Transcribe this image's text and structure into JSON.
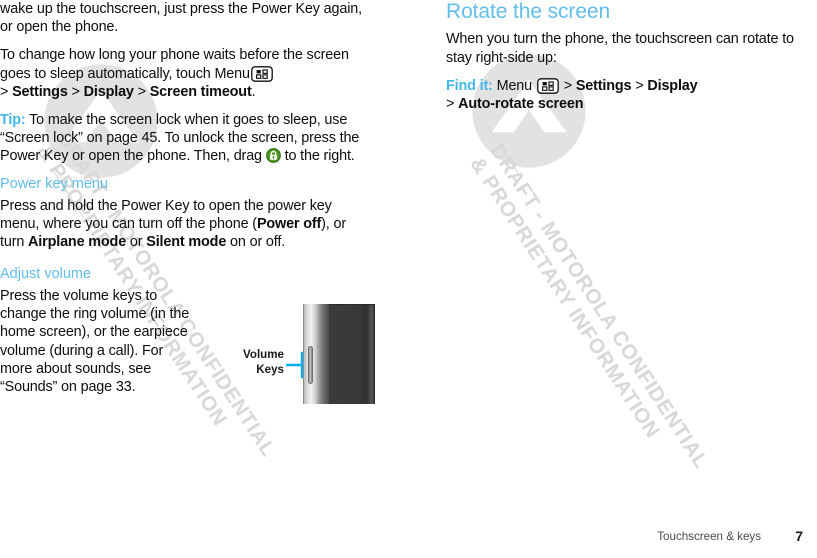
{
  "document": {
    "watermark": {
      "line1": "DRAFT - MOTOROLA CONFIDENTIAL",
      "line2": "& PROPRIETARY INFORMATION",
      "logo_name": "motorola-m-logo",
      "color": "#d8d8d8"
    },
    "footer": {
      "section_title": "Touchscreen & keys",
      "page_number": "7"
    },
    "colors": {
      "heading": "#62bdeb",
      "subheading": "#62bdeb",
      "lead_in": "#45b6e8",
      "body": "#0d0d0d",
      "callout_rule": "#00b0f0",
      "lock_icon": "#3f8f1e"
    }
  },
  "left_column": {
    "continued_paragraph": {
      "part1": "wake up the touchscreen, just press the Power Key again, or open the phone."
    },
    "timeout_paragraph": {
      "part1": "To change how long your phone waits before the screen goes to sleep automatically, touch Menu",
      "icon": "menu-grid-icon",
      "part2": " > ",
      "bold1": "Settings",
      "sep1": " > ",
      "bold2": "Display",
      "sep2": " > ",
      "bold3": "Screen timeout",
      "part3": "."
    },
    "tip_paragraph": {
      "label": "Tip:",
      "part1": " To make the screen lock when it goes to sleep, use “Screen lock” on page 45. To unlock the screen, press the Power Key or open the phone. Then, drag ",
      "icon": "lock-icon",
      "part2": " to the right."
    },
    "power_key_menu": {
      "heading": "Power key menu",
      "part1": "Press and hold the Power Key to open the power key menu, where you can turn off the phone (",
      "bold1": "Power off",
      "part2": "), or turn ",
      "bold2": "Airplane mode",
      "part3": " or ",
      "bold3": "Silent mode",
      "part4": " on or off."
    },
    "adjust_volume": {
      "heading": "Adjust volume",
      "paragraph": "Press the volume keys to change the ring volume (in the home screen), or the earpiece volume (during a call). For more about sounds, see “Sounds” on page 33."
    },
    "figure": {
      "callout_line1": "Volume",
      "callout_line2": "Keys",
      "image_name": "phone-side-view"
    }
  },
  "right_column": {
    "rotate_the_screen": {
      "heading": "Rotate the screen",
      "paragraph": "When you turn the phone, the touchscreen can rotate to stay right-side up:",
      "find_it": {
        "label": "Find it:",
        "menu_word": " Menu ",
        "icon": "menu-grid-icon",
        "sep1": " > ",
        "bold1": "Settings",
        "sep2": " > ",
        "bold2": "Display",
        "sep3": "> ",
        "bold3": "Auto-rotate screen"
      }
    }
  }
}
